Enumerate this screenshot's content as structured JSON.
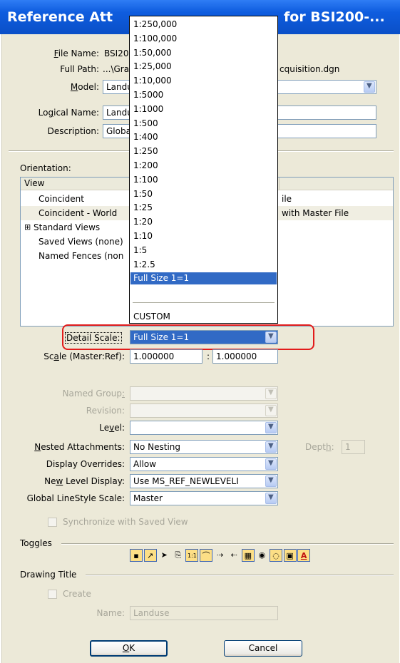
{
  "title": {
    "left": "Reference Att",
    "right": "for BSI200-..."
  },
  "file": {
    "name_label": "File Name:",
    "name_value": "BSI20",
    "path_label": "Full Path:",
    "path_value": "...\\Gra",
    "path_suffix": "cquisition.dgn"
  },
  "model": {
    "label": "Model:",
    "value": "Landu"
  },
  "logical_name": {
    "label": "Logical Name:",
    "value": "Landu"
  },
  "description": {
    "label": "Description:",
    "value": "Globa"
  },
  "orientation": {
    "label": "Orientation:",
    "header": "View",
    "rows": [
      {
        "name": "Coincident",
        "desc": "ile"
      },
      {
        "name": "Coincident - World",
        "desc": "with Master File"
      },
      {
        "name": "Standard Views",
        "desc": ""
      },
      {
        "name": "Saved Views (none)",
        "desc": ""
      },
      {
        "name": "Named Fences (non",
        "desc": ""
      }
    ],
    "expand_glyph": "⊞"
  },
  "scale_dropdown": {
    "options": [
      "1:250,000",
      "1:100,000",
      "1:50,000",
      "1:25,000",
      "1:10,000",
      "1:5000",
      "1:1000",
      "1:500",
      "1:400",
      "1:250",
      "1:200",
      "1:100",
      "1:50",
      "1:25",
      "1:20",
      "1:10",
      "1:5",
      "1:2.5",
      "Full Size 1=1"
    ],
    "selected": "Full Size 1=1",
    "custom": "CUSTOM"
  },
  "detail_scale": {
    "label": "Detail Scale:",
    "value": "Full Size 1=1"
  },
  "scale": {
    "label_pre": "Sc",
    "label_u": "a",
    "label_post": "le (Master:Ref):",
    "master": "1.000000",
    "sep": ":",
    "ref": "1.000000"
  },
  "named_group": {
    "label_pre": "Named Group",
    "label_u": ":",
    "value": ""
  },
  "revision": {
    "label": "Revision:",
    "value": ""
  },
  "level": {
    "label_pre": "Le",
    "label_u": "v",
    "label_post": "el:",
    "value": ""
  },
  "nested": {
    "label_u": "N",
    "label_post": "ested Attachments:",
    "value": "No Nesting",
    "depth_label_pre": "Dept",
    "depth_label_u": "h",
    "depth_label_post": ":",
    "depth_value": "1"
  },
  "display_overrides": {
    "label": "Display Overrides:",
    "value": "Allow"
  },
  "new_level_display": {
    "label_pre": "Ne",
    "label_u": "w",
    "label_post": " Level Display:",
    "value": "Use MS_REF_NEWLEVELI"
  },
  "global_linestyle": {
    "label": "Global LineStyle Scale:",
    "value": "Master"
  },
  "sync": {
    "label": "Synchronize with Saved View",
    "checked": false
  },
  "toggles": {
    "label": "Toggles",
    "icons": [
      "display-toggle-icon",
      "snap-toggle-icon",
      "locate-arrow-icon",
      "lock-toggle-icon",
      "scale-lines-icon",
      "linestyle-toggle-icon",
      "ignore-attachment-icon",
      "treat-as-element-icon",
      "grid-icon",
      "fill-icon",
      "light-bulb-icon",
      "clip-icon",
      "text-color-icon"
    ],
    "glyphs": [
      "▪",
      "↗",
      "➤",
      "⎘",
      "1:1",
      "⌒",
      "⇢",
      "⇠",
      "▦",
      "◉",
      "◌",
      "▣",
      "A"
    ]
  },
  "drawing_title": {
    "label": "Drawing Title",
    "create_label": "Create",
    "name_label": "Name:",
    "name_value": "Landuse"
  },
  "buttons": {
    "ok_u": "O",
    "ok_rest": "K",
    "cancel": "Cancel"
  },
  "colors": {
    "title_bar": "#0f5ddf",
    "dialog_bg": "#ece9d8",
    "highlight": "#316ac5",
    "callout": "#e21b1b"
  }
}
